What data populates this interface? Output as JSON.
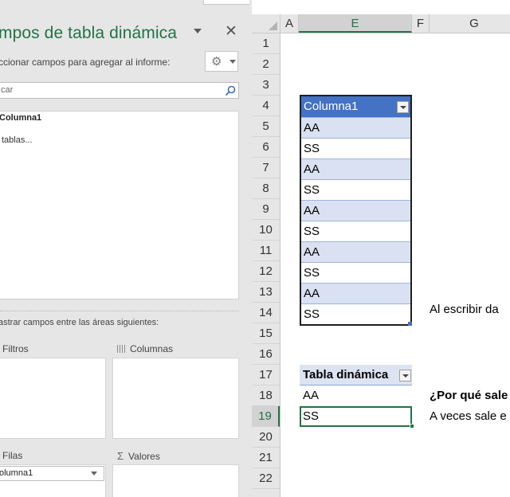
{
  "pivot_pane": {
    "title": "mpos de tabla dinámica",
    "choose_fields_label": "ccionar campos para agregar al informe:",
    "search_placeholder": "car",
    "fields": [
      "Columna1"
    ],
    "more_tables": "tablas...",
    "drag_label": "astrar campos entre las áreas siguientes:",
    "areas": {
      "filters": "Filtros",
      "columns": "Columnas",
      "rows": "Filas",
      "values": "Valores"
    },
    "rows_field": "olumna1",
    "icons": {
      "close": "close-icon",
      "gear": "gear-icon",
      "search": "search-icon",
      "sigma": "sigma-icon"
    }
  },
  "sheet": {
    "columns": [
      "A",
      "E",
      "F",
      "G"
    ],
    "selected_column": "E",
    "rows": [
      "1",
      "2",
      "3",
      "4",
      "5",
      "6",
      "7",
      "8",
      "9",
      "10",
      "11",
      "12",
      "13",
      "14",
      "15",
      "16",
      "17",
      "18",
      "19",
      "20",
      "21",
      "22"
    ],
    "selected_row": "19",
    "table": {
      "header": "Columna1",
      "values": [
        "AA",
        "SS",
        "AA",
        "SS",
        "AA",
        "SS",
        "AA",
        "SS",
        "AA",
        "SS"
      ]
    },
    "pivot": {
      "header": "Tabla dinámica",
      "values": [
        "AA",
        "SS"
      ]
    },
    "notes": {
      "row14": "Al escribir da",
      "row18": "¿Por qué sale",
      "row19": "A veces sale e"
    },
    "colors": {
      "accent": "#217346",
      "table_header": "#4472c4",
      "band": "#d9e1f2"
    }
  }
}
